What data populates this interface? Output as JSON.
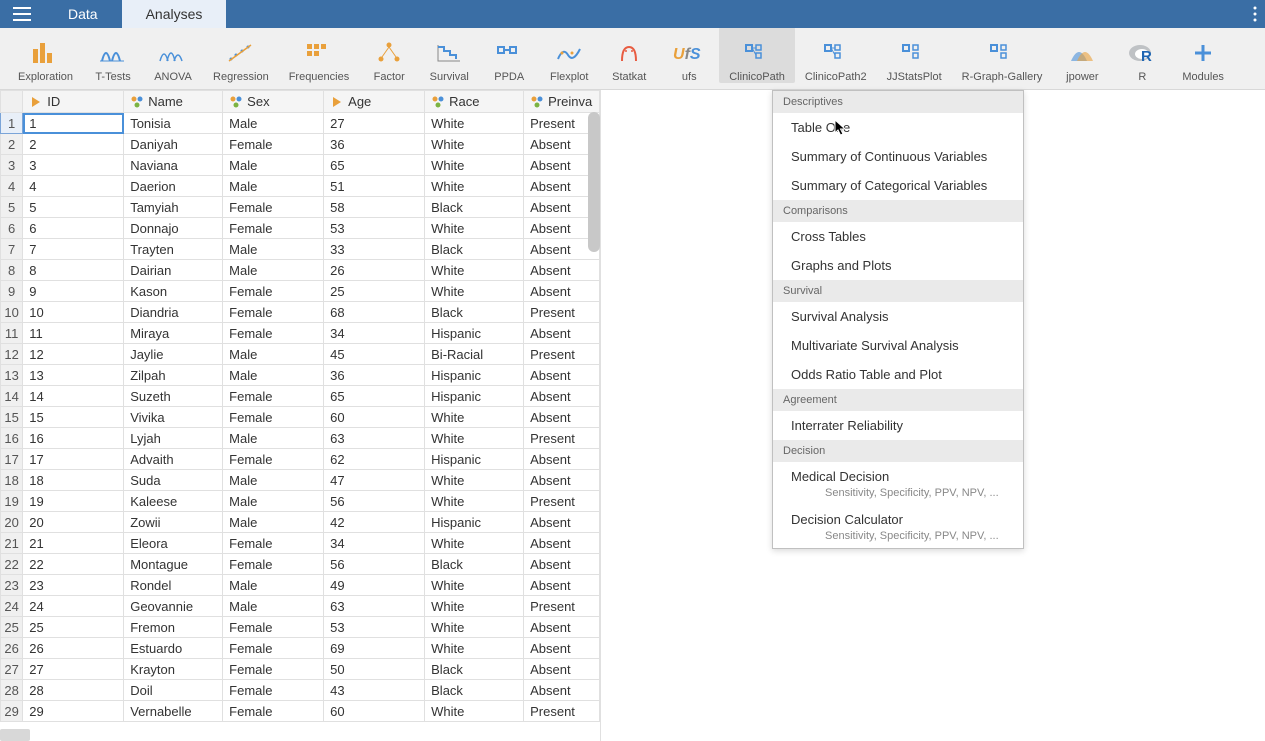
{
  "tabs": {
    "data": "Data",
    "analyses": "Analyses"
  },
  "ribbon": [
    {
      "id": "exploration",
      "label": "Exploration"
    },
    {
      "id": "ttests",
      "label": "T-Tests"
    },
    {
      "id": "anova",
      "label": "ANOVA"
    },
    {
      "id": "regression",
      "label": "Regression"
    },
    {
      "id": "frequencies",
      "label": "Frequencies"
    },
    {
      "id": "factor",
      "label": "Factor"
    },
    {
      "id": "survival",
      "label": "Survival"
    },
    {
      "id": "ppda",
      "label": "PPDA"
    },
    {
      "id": "flexplot",
      "label": "Flexplot"
    },
    {
      "id": "statkat",
      "label": "Statkat"
    },
    {
      "id": "ufs",
      "label": "ufs"
    },
    {
      "id": "clinicopath",
      "label": "ClinicoPath"
    },
    {
      "id": "clinicopath2",
      "label": "ClinicoPath2"
    },
    {
      "id": "jjstatsplot",
      "label": "JJStatsPlot"
    },
    {
      "id": "rgraphgallery",
      "label": "R-Graph-Gallery"
    },
    {
      "id": "jpower",
      "label": "jpower"
    },
    {
      "id": "r",
      "label": "R"
    },
    {
      "id": "modules",
      "label": "Modules"
    }
  ],
  "columns": [
    "ID",
    "Name",
    "Sex",
    "Age",
    "Race",
    "Preinva"
  ],
  "rows": [
    {
      "n": 1,
      "id": 1,
      "name": "Tonisia",
      "sex": "Male",
      "age": 27,
      "race": "White",
      "preinva": "Present"
    },
    {
      "n": 2,
      "id": 2,
      "name": "Daniyah",
      "sex": "Female",
      "age": 36,
      "race": "White",
      "preinva": "Absent"
    },
    {
      "n": 3,
      "id": 3,
      "name": "Naviana",
      "sex": "Male",
      "age": 65,
      "race": "White",
      "preinva": "Absent"
    },
    {
      "n": 4,
      "id": 4,
      "name": "Daerion",
      "sex": "Male",
      "age": 51,
      "race": "White",
      "preinva": "Absent"
    },
    {
      "n": 5,
      "id": 5,
      "name": "Tamyiah",
      "sex": "Female",
      "age": 58,
      "race": "Black",
      "preinva": "Absent"
    },
    {
      "n": 6,
      "id": 6,
      "name": "Donnajo",
      "sex": "Female",
      "age": 53,
      "race": "White",
      "preinva": "Absent"
    },
    {
      "n": 7,
      "id": 7,
      "name": "Trayten",
      "sex": "Male",
      "age": 33,
      "race": "Black",
      "preinva": "Absent"
    },
    {
      "n": 8,
      "id": 8,
      "name": "Dairian",
      "sex": "Male",
      "age": 26,
      "race": "White",
      "preinva": "Absent"
    },
    {
      "n": 9,
      "id": 9,
      "name": "Kason",
      "sex": "Female",
      "age": 25,
      "race": "White",
      "preinva": "Absent"
    },
    {
      "n": 10,
      "id": 10,
      "name": "Diandria",
      "sex": "Female",
      "age": 68,
      "race": "Black",
      "preinva": "Present"
    },
    {
      "n": 11,
      "id": 11,
      "name": "Miraya",
      "sex": "Female",
      "age": 34,
      "race": "Hispanic",
      "preinva": "Absent"
    },
    {
      "n": 12,
      "id": 12,
      "name": "Jaylie",
      "sex": "Male",
      "age": 45,
      "race": "Bi-Racial",
      "preinva": "Present"
    },
    {
      "n": 13,
      "id": 13,
      "name": "Zilpah",
      "sex": "Male",
      "age": 36,
      "race": "Hispanic",
      "preinva": "Absent"
    },
    {
      "n": 14,
      "id": 14,
      "name": "Suzeth",
      "sex": "Female",
      "age": 65,
      "race": "Hispanic",
      "preinva": "Absent"
    },
    {
      "n": 15,
      "id": 15,
      "name": "Vivika",
      "sex": "Female",
      "age": 60,
      "race": "White",
      "preinva": "Absent"
    },
    {
      "n": 16,
      "id": 16,
      "name": "Lyjah",
      "sex": "Male",
      "age": 63,
      "race": "White",
      "preinva": "Present"
    },
    {
      "n": 17,
      "id": 17,
      "name": "Advaith",
      "sex": "Female",
      "age": 62,
      "race": "Hispanic",
      "preinva": "Absent"
    },
    {
      "n": 18,
      "id": 18,
      "name": "Suda",
      "sex": "Male",
      "age": 47,
      "race": "White",
      "preinva": "Absent"
    },
    {
      "n": 19,
      "id": 19,
      "name": "Kaleese",
      "sex": "Male",
      "age": 56,
      "race": "White",
      "preinva": "Present"
    },
    {
      "n": 20,
      "id": 20,
      "name": "Zowii",
      "sex": "Male",
      "age": 42,
      "race": "Hispanic",
      "preinva": "Absent"
    },
    {
      "n": 21,
      "id": 21,
      "name": "Eleora",
      "sex": "Female",
      "age": 34,
      "race": "White",
      "preinva": "Absent"
    },
    {
      "n": 22,
      "id": 22,
      "name": "Montague",
      "sex": "Female",
      "age": 56,
      "race": "Black",
      "preinva": "Absent"
    },
    {
      "n": 23,
      "id": 23,
      "name": "Rondel",
      "sex": "Male",
      "age": 49,
      "race": "White",
      "preinva": "Absent"
    },
    {
      "n": 24,
      "id": 24,
      "name": "Geovannie",
      "sex": "Male",
      "age": 63,
      "race": "White",
      "preinva": "Present"
    },
    {
      "n": 25,
      "id": 25,
      "name": "Fremon",
      "sex": "Female",
      "age": 53,
      "race": "White",
      "preinva": "Absent"
    },
    {
      "n": 26,
      "id": 26,
      "name": "Estuardo",
      "sex": "Female",
      "age": 69,
      "race": "White",
      "preinva": "Absent"
    },
    {
      "n": 27,
      "id": 27,
      "name": "Krayton",
      "sex": "Female",
      "age": 50,
      "race": "Black",
      "preinva": "Absent"
    },
    {
      "n": 28,
      "id": 28,
      "name": "Doil",
      "sex": "Female",
      "age": 43,
      "race": "Black",
      "preinva": "Absent"
    },
    {
      "n": 29,
      "id": 29,
      "name": "Vernabelle",
      "sex": "Female",
      "age": 60,
      "race": "White",
      "preinva": "Present"
    }
  ],
  "dropdown": {
    "sections": [
      {
        "title": "Descriptives",
        "items": [
          {
            "label": "Table One"
          },
          {
            "label": "Summary of Continuous Variables"
          },
          {
            "label": "Summary of Categorical Variables"
          }
        ]
      },
      {
        "title": "Comparisons",
        "items": [
          {
            "label": "Cross Tables"
          },
          {
            "label": "Graphs and Plots"
          }
        ]
      },
      {
        "title": "Survival",
        "items": [
          {
            "label": "Survival Analysis"
          },
          {
            "label": "Multivariate Survival Analysis"
          },
          {
            "label": "Odds Ratio Table and Plot"
          }
        ]
      },
      {
        "title": "Agreement",
        "items": [
          {
            "label": "Interrater Reliability"
          }
        ]
      },
      {
        "title": "Decision",
        "items": [
          {
            "label": "Medical Decision",
            "sub": "Sensitivity, Specificity, PPV, NPV, ..."
          },
          {
            "label": "Decision Calculator",
            "sub": "Sensitivity, Specificity, PPV, NPV, ..."
          }
        ]
      }
    ]
  }
}
